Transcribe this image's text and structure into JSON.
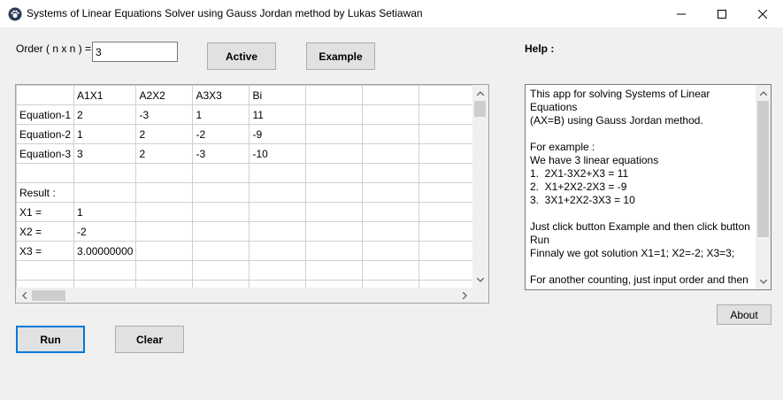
{
  "window": {
    "title": "Systems of Linear Equations Solver using Gauss Jordan method by Lukas Setiawan",
    "icon": "paw-icon"
  },
  "order": {
    "label": "Order ( n x n ) =",
    "value": "3"
  },
  "buttons": {
    "active": "Active",
    "example": "Example",
    "run": "Run",
    "clear": "Clear",
    "about": "About"
  },
  "grid": {
    "headers": [
      "",
      "A1X1",
      "A2X2",
      "A3X3",
      "Bi",
      "",
      "",
      ""
    ],
    "rows": [
      [
        "Equation-1",
        "2",
        "-3",
        "1",
        "11",
        "",
        "",
        ""
      ],
      [
        "Equation-2",
        "1",
        "2",
        "-2",
        "-9",
        "",
        "",
        ""
      ],
      [
        "Equation-3",
        "3",
        "2",
        "-3",
        "-10",
        "",
        "",
        ""
      ],
      [
        "",
        "",
        "",
        "",
        "",
        "",
        "",
        ""
      ],
      [
        "Result :",
        "",
        "",
        "",
        "",
        "",
        "",
        ""
      ],
      [
        "X1 =",
        "1",
        "",
        "",
        "",
        "",
        "",
        ""
      ],
      [
        "X2 =",
        "-2",
        "",
        "",
        "",
        "",
        "",
        ""
      ],
      [
        "X3 =",
        "3.00000000",
        "",
        "",
        "",
        "",
        "",
        ""
      ],
      [
        "",
        "",
        "",
        "",
        "",
        "",
        "",
        ""
      ],
      [
        "",
        "",
        "",
        "",
        "",
        "",
        "",
        ""
      ]
    ]
  },
  "help": {
    "label": "Help :",
    "text": "This app for solving Systems of Linear Equations\n(AX=B) using Gauss Jordan method.\n\nFor example :\nWe have 3 linear equations\n1.  2X1-3X2+X3 = 11\n2.  X1+2X2-2X3 = -9\n3.  3X1+2X2-3X3 = 10\n\nJust click button Example and then click button Run\nFinnaly we got solution X1=1; X2=-2; X3=3;\n\nFor another counting, just input order and then"
  }
}
